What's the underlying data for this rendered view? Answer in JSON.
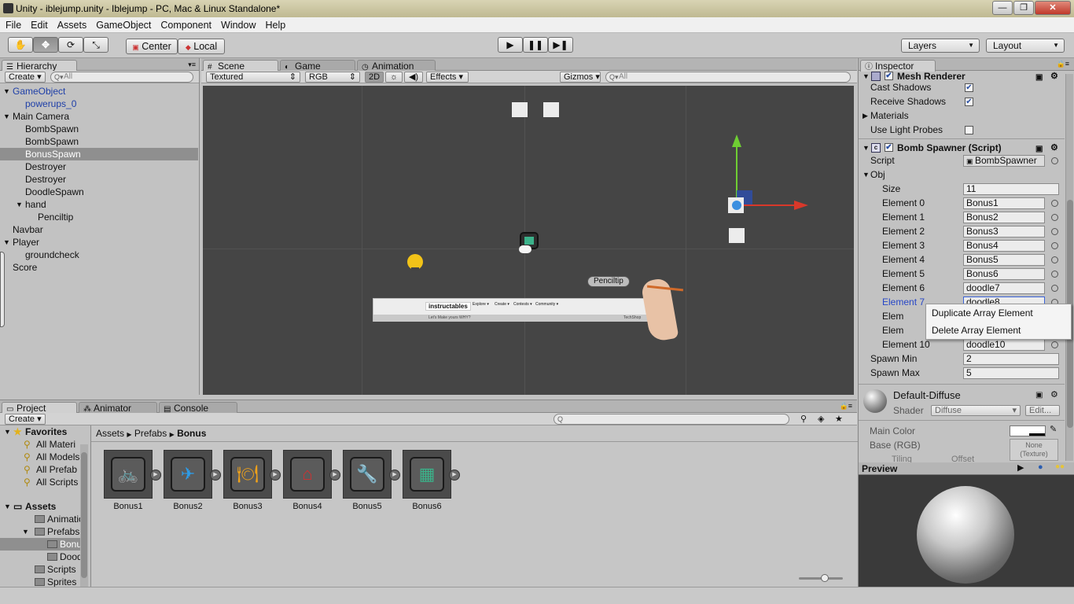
{
  "window": {
    "title": "Unity - iblejump.unity - Iblejump - PC, Mac & Linux Standalone*",
    "min": "—",
    "max": "❐",
    "close": "✕"
  },
  "menu": [
    "File",
    "Edit",
    "Assets",
    "GameObject",
    "Component",
    "Window",
    "Help"
  ],
  "toolbar": {
    "tools": [
      "hand",
      "move",
      "rotate",
      "scale"
    ],
    "pivot": "Center",
    "space": "Local",
    "layers": "Layers",
    "layout": "Layout"
  },
  "hierarchy": {
    "tab": "Hierarchy",
    "create": "Create",
    "search_placeholder": "All",
    "items": [
      {
        "label": "GameObject",
        "indent": 0,
        "fold": "open",
        "blue": true
      },
      {
        "label": "powerups_0",
        "indent": 1,
        "fold": "",
        "blue": true
      },
      {
        "label": "Main Camera",
        "indent": 0,
        "fold": "open",
        "blue": false
      },
      {
        "label": "BombSpawn",
        "indent": 1,
        "fold": "",
        "blue": false
      },
      {
        "label": "BombSpawn",
        "indent": 1,
        "fold": "",
        "blue": false
      },
      {
        "label": "BonusSpawn",
        "indent": 1,
        "fold": "",
        "blue": false,
        "selected": true
      },
      {
        "label": "Destroyer",
        "indent": 1,
        "fold": "",
        "blue": false
      },
      {
        "label": "Destroyer",
        "indent": 1,
        "fold": "",
        "blue": false
      },
      {
        "label": "DoodleSpawn",
        "indent": 1,
        "fold": "",
        "blue": false
      },
      {
        "label": "hand",
        "indent": 1,
        "fold": "open",
        "blue": false
      },
      {
        "label": "Penciltip",
        "indent": 2,
        "fold": "",
        "blue": false
      },
      {
        "label": "Navbar",
        "indent": 0,
        "fold": "",
        "blue": false
      },
      {
        "label": "Player",
        "indent": 0,
        "fold": "open",
        "blue": false
      },
      {
        "label": "groundcheck",
        "indent": 1,
        "fold": "",
        "blue": false
      },
      {
        "label": "Score",
        "indent": 0,
        "fold": "",
        "blue": false
      }
    ]
  },
  "scene": {
    "tabs": [
      "Scene",
      "Game",
      "Animation"
    ],
    "shading": "Textured",
    "render_mode": "RGB",
    "mode_2d": "2D",
    "effects": "Effects",
    "gizmos": "Gizmos",
    "search_placeholder": "All",
    "penciltip_label": "Penciltip",
    "navbar_logo": "instructables",
    "navbar_items": [
      "Explore ▾",
      "Create ▾",
      "Contests ▾",
      "Community ▾"
    ],
    "navbar_small_left": "Let's Make yours WHY?",
    "navbar_small_right": "TechShop"
  },
  "inspector": {
    "tab": "Inspector",
    "mesh_renderer": "Mesh Renderer",
    "cast_shadows": "Cast Shadows",
    "receive_shadows": "Receive Shadows",
    "materials": "Materials",
    "use_light_probes": "Use Light Probes",
    "component": "Bomb Spawner (Script)",
    "script_label": "Script",
    "script_value": "BombSpawner",
    "obj_label": "Obj",
    "size_label": "Size",
    "size_value": "11",
    "elements": [
      {
        "label": "Element 0",
        "value": "Bonus1"
      },
      {
        "label": "Element 1",
        "value": "Bonus2"
      },
      {
        "label": "Element 2",
        "value": "Bonus3"
      },
      {
        "label": "Element 3",
        "value": "Bonus4"
      },
      {
        "label": "Element 4",
        "value": "Bonus5"
      },
      {
        "label": "Element 5",
        "value": "Bonus6"
      },
      {
        "label": "Element 6",
        "value": "doodle7"
      },
      {
        "label": "Element 7",
        "value": "doodle8"
      },
      {
        "label": "Elem",
        "value": ""
      },
      {
        "label": "Elem",
        "value": ""
      },
      {
        "label": "Element 10",
        "value": "doodle10"
      }
    ],
    "spawn_min_label": "Spawn Min",
    "spawn_min": "2",
    "spawn_max_label": "Spawn Max",
    "spawn_max": "5",
    "material_name": "Default-Diffuse",
    "shader_label": "Shader",
    "shader_value": "Diffuse",
    "edit": "Edit...",
    "main_color": "Main Color",
    "base_rgb": "Base (RGB)",
    "none_texture": "None\n(Texture)",
    "tiling": "Tiling",
    "offset": "Offset"
  },
  "context_menu": [
    "Duplicate Array Element",
    "Delete Array Element"
  ],
  "project": {
    "tabs": [
      "Project",
      "Animator",
      "Console"
    ],
    "create": "Create",
    "breadcrumb": [
      "Assets",
      "Prefabs",
      "Bonus"
    ],
    "favorites_header": "Favorites",
    "favorites": [
      "All Materi",
      "All Models",
      "All Prefab",
      "All Scripts"
    ],
    "assets_header": "Assets",
    "folders": [
      {
        "label": "Animation",
        "indent": 1,
        "fold": ""
      },
      {
        "label": "Prefabs",
        "indent": 1,
        "fold": "open"
      },
      {
        "label": "Bonus",
        "indent": 2,
        "fold": "",
        "selected": true
      },
      {
        "label": "Doodle",
        "indent": 2,
        "fold": ""
      },
      {
        "label": "Scripts",
        "indent": 1,
        "fold": ""
      },
      {
        "label": "Sprites",
        "indent": 1,
        "fold": ""
      }
    ],
    "assets": [
      {
        "label": "Bonus1",
        "icon": "bicycle-icon",
        "glyph": "🚲",
        "color": "#d7e03a"
      },
      {
        "label": "Bonus2",
        "icon": "paper-plane-icon",
        "glyph": "✈",
        "color": "#2e9be6"
      },
      {
        "label": "Bonus3",
        "icon": "plate-cutlery-icon",
        "glyph": "🍽",
        "color": "#f0a21a"
      },
      {
        "label": "Bonus4",
        "icon": "house-icon",
        "glyph": "⌂",
        "color": "#d03030"
      },
      {
        "label": "Bonus5",
        "icon": "tools-icon",
        "glyph": "🔧",
        "color": "#f08a1a"
      },
      {
        "label": "Bonus6",
        "icon": "chip-icon",
        "glyph": "▦",
        "color": "#3bb28a"
      }
    ]
  },
  "preview": {
    "title": "Preview"
  }
}
